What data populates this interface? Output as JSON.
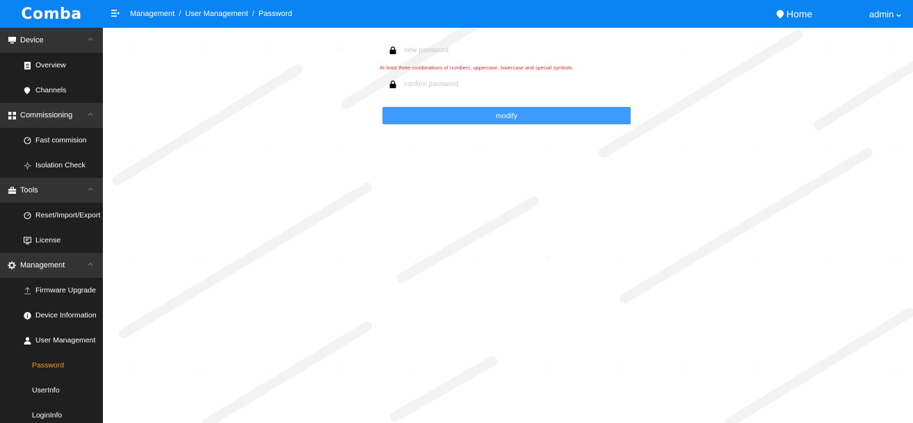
{
  "app": {
    "logo": "Comba"
  },
  "header": {
    "breadcrumb": [
      "Management",
      "User Management",
      "Password"
    ],
    "breadcrumb_separator": "/",
    "home_label": "Home",
    "user_label": "admin"
  },
  "sidebar": {
    "groups": [
      {
        "label": "Device",
        "icon": "monitor-icon",
        "items": [
          {
            "label": "Overview",
            "icon": "document-icon"
          },
          {
            "label": "Channels",
            "icon": "pin-icon"
          }
        ]
      },
      {
        "label": "Commissioning",
        "icon": "grid-icon",
        "items": [
          {
            "label": "Fast commision",
            "icon": "speed-icon"
          },
          {
            "label": "Isolation Check",
            "icon": "sparkle-icon"
          }
        ]
      },
      {
        "label": "Tools",
        "icon": "toolbox-icon",
        "items": [
          {
            "label": "Reset/Import/Export",
            "icon": "speed-icon"
          },
          {
            "label": "License",
            "icon": "license-icon"
          }
        ]
      },
      {
        "label": "Management",
        "icon": "gear-icon",
        "items": [
          {
            "label": "Firmware Upgrade",
            "icon": "upload-icon"
          },
          {
            "label": "Device Information",
            "icon": "info-icon"
          },
          {
            "label": "User Management",
            "icon": "user-icon"
          }
        ]
      }
    ],
    "user_management_subitems": [
      {
        "label": "Password",
        "active": true
      },
      {
        "label": "UserInfo",
        "active": false
      },
      {
        "label": "LoginInfo",
        "active": false
      }
    ]
  },
  "form": {
    "new_password_placeholder": "new password",
    "hint": "At least three combinations of numbers, uppercase, lowercase and special symbols",
    "confirm_password_placeholder": "confirm password",
    "modify_label": "modify"
  },
  "colors": {
    "accent": "#0b84f3",
    "button": "#3d9aff",
    "sidebar_bg": "#1f1f1f",
    "sidebar_group_bg": "#333333",
    "active_item": "#f39c12",
    "error_hint": "#e8303a"
  }
}
